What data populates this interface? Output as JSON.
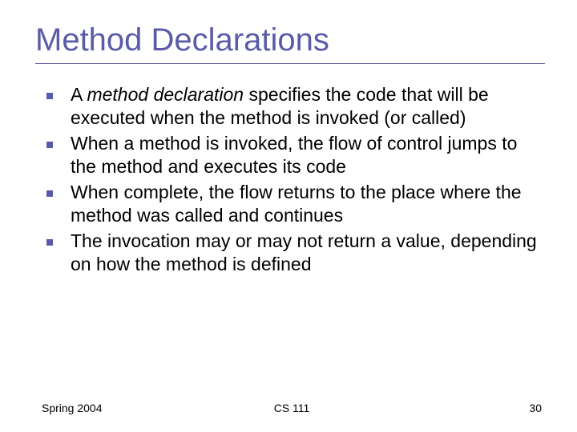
{
  "title": "Method Declarations",
  "bullets": [
    {
      "pre": "A ",
      "em": "method declaration",
      "post": " specifies the code that will be executed when the method is invoked (or called)"
    },
    {
      "pre": "When a method is invoked, the flow of control jumps to the method and executes its code",
      "em": "",
      "post": ""
    },
    {
      "pre": "When complete, the flow returns to the place where the method was called and continues",
      "em": "",
      "post": ""
    },
    {
      "pre": "The invocation may or may not return a value, depending on how the method is defined",
      "em": "",
      "post": ""
    }
  ],
  "footer": {
    "left": "Spring 2004",
    "center": "CS 111",
    "right": "30"
  }
}
